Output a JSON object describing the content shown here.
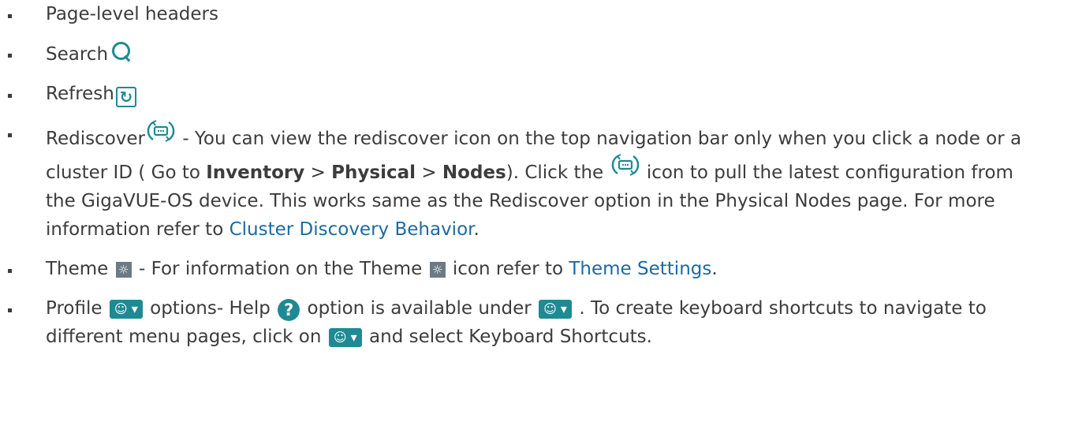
{
  "items": [
    {
      "text": "Page-level headers"
    },
    {
      "label": "Search",
      "icon": "search-icon"
    },
    {
      "label": "Refresh",
      "icon": "refresh-icon"
    },
    {
      "label": "Rediscover",
      "icon": "rediscover-icon",
      "t1": " - You can view the rediscover icon on the top navigation bar only when you click a node or a cluster ID ( Go to ",
      "inventory": "Inventory",
      "gt1": " > ",
      "physical": "Physical",
      "gt2": " > ",
      "nodes": "Nodes",
      "t2": "). Click the ",
      "t3": " icon to pull the latest configuration from the GigaVUE-OS device. This works same as the Rediscover option in the Physical Nodes page. For more information refer to ",
      "link": "Cluster Discovery Behavior",
      "t4": "."
    },
    {
      "label": "Theme",
      "icon": "theme-icon",
      "t1": " - For information on the Theme ",
      "t2": " icon refer to ",
      "link": "Theme Settings",
      "t3": "."
    },
    {
      "label": "Profile",
      "icon": "profile-icon",
      "t1": " options- Help ",
      "t2": " option is available under ",
      "t3": " . To create keyboard shortcuts to navigate to different menu pages, click on ",
      "t4": " and select Keyboard Shortcuts."
    }
  ],
  "icons": {
    "refresh_glyph": "↻",
    "theme_glyph": "☼",
    "profile_glyph": "☺ ▾",
    "help_glyph": "?"
  },
  "colors": {
    "text": "#3c3c3c",
    "link": "#1d6aa0",
    "icon_teal": "#1f8a93",
    "theme_gray": "#6c7a85"
  }
}
